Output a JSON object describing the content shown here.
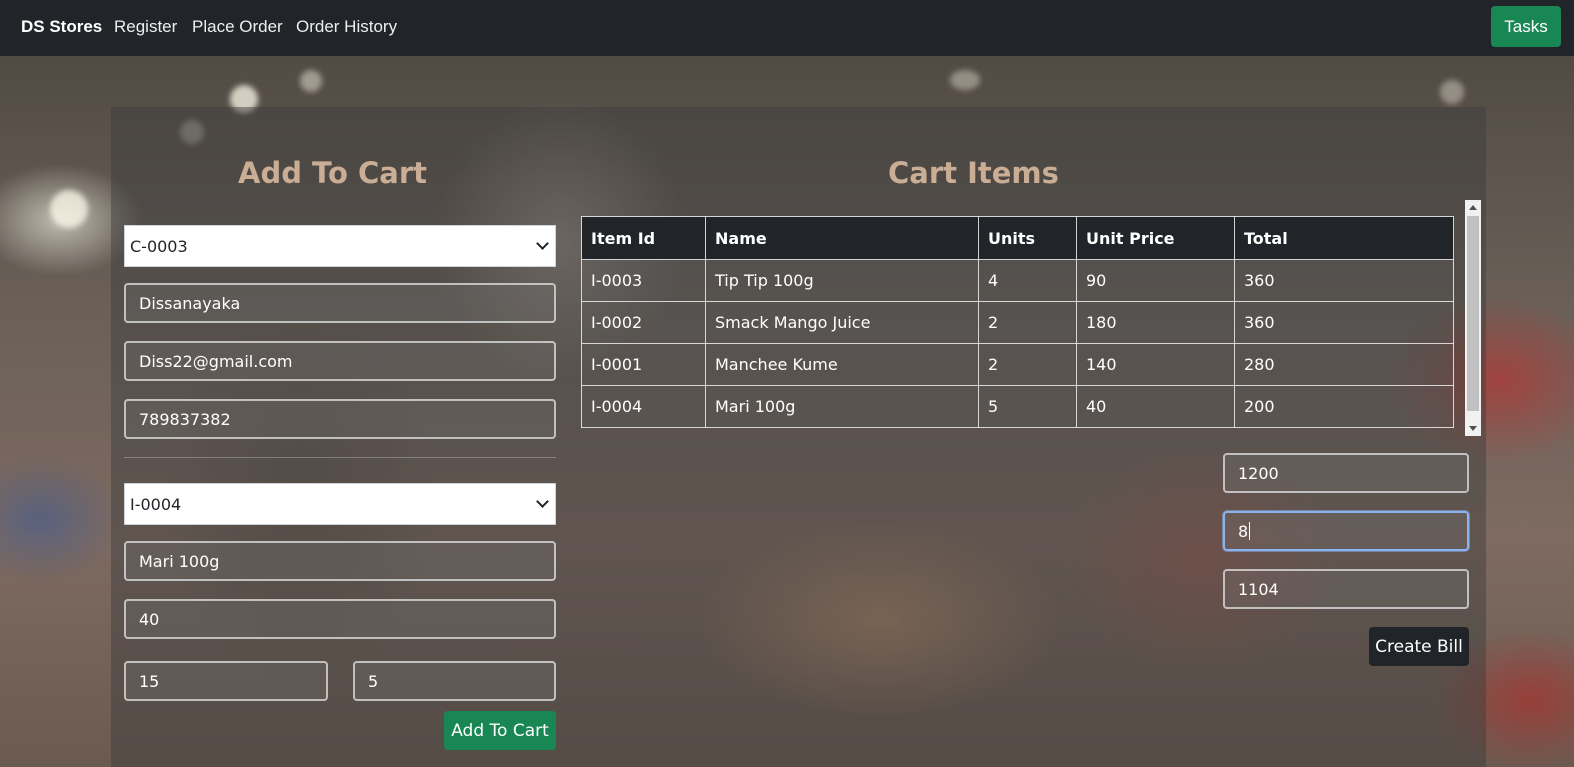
{
  "nav": {
    "brand": "DS Stores",
    "links": [
      "Register",
      "Place Order",
      "Order History"
    ],
    "tasks_label": "Tasks"
  },
  "add_to_cart": {
    "title": "Add To Cart",
    "customer_id": "C-0003",
    "customer_name": "Dissanayaka",
    "customer_email": "Diss22@gmail.com",
    "customer_phone": "789837382",
    "item_id": "I-0004",
    "item_name": "Mari 100g",
    "unit_price": "40",
    "qty_on_hand": "15",
    "order_qty": "5",
    "add_button": "Add To Cart"
  },
  "cart": {
    "title": "Cart Items",
    "columns": [
      "Item Id",
      "Name",
      "Units",
      "Unit Price",
      "Total"
    ],
    "rows": [
      [
        "I-0003",
        "Tip Tip 100g",
        "4",
        "90",
        "360"
      ],
      [
        "I-0002",
        "Smack Mango Juice",
        "2",
        "180",
        "360"
      ],
      [
        "I-0001",
        "Manchee Kume",
        "2",
        "140",
        "280"
      ],
      [
        "I-0004",
        "Mari 100g",
        "5",
        "40",
        "200"
      ]
    ],
    "subtotal": "1200",
    "discount": "8",
    "net_total": "1104",
    "create_bill": "Create Bill"
  },
  "colors": {
    "navbar": "#212529",
    "success": "#198754",
    "title": "#c9ad95"
  }
}
